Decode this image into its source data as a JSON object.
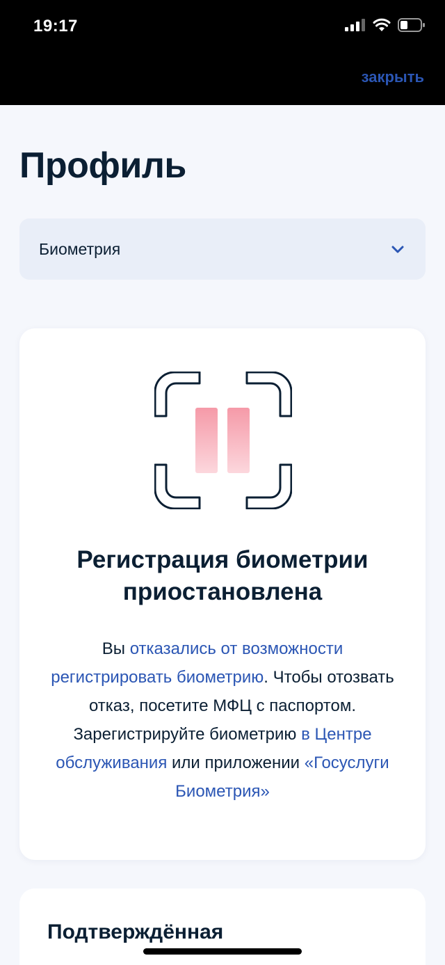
{
  "status_bar": {
    "time": "19:17",
    "icons": [
      "signal-icon",
      "wifi-icon",
      "battery-icon"
    ]
  },
  "header": {
    "close_label": "закрыть"
  },
  "page": {
    "title": "Профиль"
  },
  "section_select": {
    "value": "Биометрия",
    "icon": "chevron-down-icon"
  },
  "biometry_card": {
    "illustration_icon": "face-scan-paused-icon",
    "title_line1": "Регистрация биометрии",
    "title_line2": "приостановлена",
    "text_1": "Вы ",
    "link_1": "отказались от возможности регистрировать биометрию",
    "text_2": ". Чтобы отозвать отказ, посетите МФЦ с паспортом. Зарегистрируйте биометрию ",
    "link_2": "в Центре обслуживания",
    "text_3": " или приложении ",
    "link_3": "«Госуслуги Биометрия»"
  },
  "confirmed_card": {
    "title": "Подтверждённая"
  },
  "colors": {
    "accent": "#2b56b4",
    "text": "#0b1f33",
    "background": "#f5f7fc",
    "select_bg": "#e9eef8",
    "pause_pink": "#f7a6b2"
  }
}
